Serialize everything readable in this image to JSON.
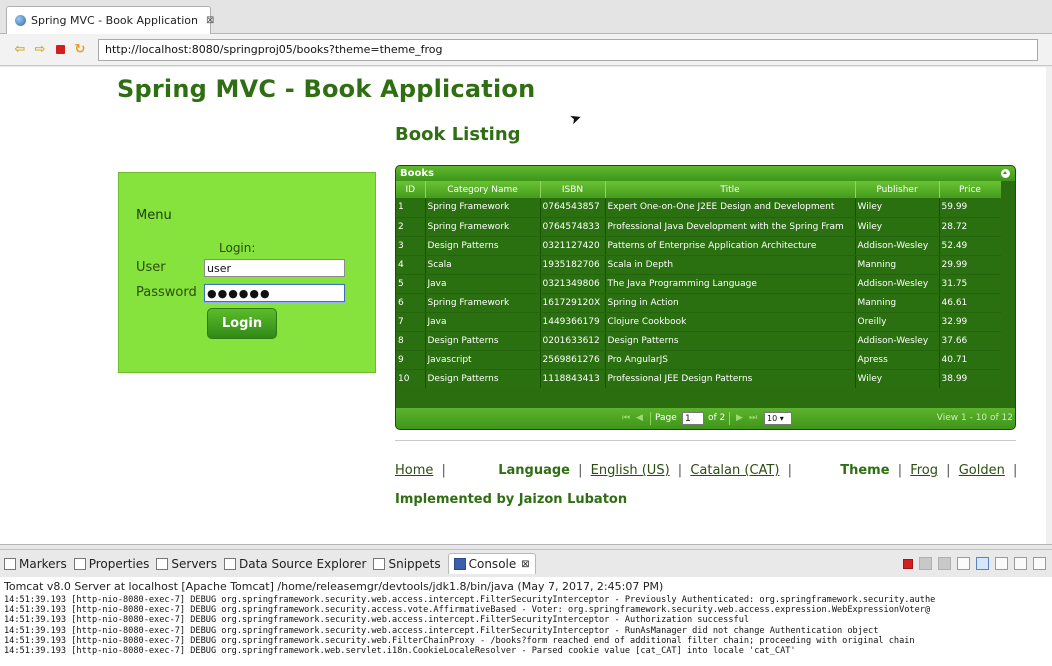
{
  "browser": {
    "tab_title": "Spring MVC - Book Application",
    "tab_close": "⊠",
    "url": "http://localhost:8080/springproj05/books?theme=theme_frog"
  },
  "page": {
    "app_title": "Spring MVC - Book Application",
    "listing_title": "Book Listing"
  },
  "menu": {
    "title": "Menu",
    "login_caption": "Login:",
    "user_label": "User",
    "user_value": "user",
    "password_label": "Password",
    "password_value": "●●●●●●",
    "login_button": "Login"
  },
  "grid": {
    "caption": "Books",
    "columns": [
      "ID",
      "Category Name",
      "ISBN",
      "Title",
      "Publisher",
      "Price"
    ],
    "rows": [
      [
        "1",
        "Spring Framework",
        "0764543857",
        "Expert One-on-One J2EE Design and Development",
        "Wiley",
        "59.99"
      ],
      [
        "2",
        "Spring Framework",
        "0764574833",
        "Professional Java Development with the Spring Fram",
        "Wiley",
        "28.72"
      ],
      [
        "3",
        "Design Patterns",
        "0321127420",
        "Patterns of Enterprise Application Architecture",
        "Addison-Wesley",
        "52.49"
      ],
      [
        "4",
        "Scala",
        "1935182706",
        "Scala in Depth",
        "Manning",
        "29.99"
      ],
      [
        "5",
        "Java",
        "0321349806",
        "The Java Programming Language",
        "Addison-Wesley",
        "31.75"
      ],
      [
        "6",
        "Spring Framework",
        "161729120X",
        "Spring in Action",
        "Manning",
        "46.61"
      ],
      [
        "7",
        "Java",
        "1449366179",
        "Clojure Cookbook",
        "Oreilly",
        "32.99"
      ],
      [
        "8",
        "Design Patterns",
        "0201633612",
        "Design Patterns",
        "Addison-Wesley",
        "37.66"
      ],
      [
        "9",
        "Javascript",
        "2569861276",
        "Pro AngularJS",
        "Apress",
        "40.71"
      ],
      [
        "10",
        "Design Patterns",
        "1118843413",
        "Professional JEE Design Patterns",
        "Wiley",
        "38.99"
      ]
    ],
    "pager": {
      "page_label": "Page",
      "page_value": "1",
      "of_label": "of 2",
      "rows_value": "10 ▾",
      "view_text": "View 1 - 10 of 12"
    }
  },
  "footer": {
    "home": "Home",
    "language_label": "Language",
    "english": "English (US)",
    "catalan": "Catalan (CAT)",
    "theme_label": "Theme",
    "frog": "Frog",
    "golden": "Golden",
    "separator": "|",
    "implemented": "Implemented by Jaizon Lubaton"
  },
  "views": {
    "tabs": [
      {
        "label": "Markers",
        "icon": "markers-icon"
      },
      {
        "label": "Properties",
        "icon": "properties-icon"
      },
      {
        "label": "Servers",
        "icon": "servers-icon"
      },
      {
        "label": "Data Source Explorer",
        "icon": "database-icon"
      },
      {
        "label": "Snippets",
        "icon": "snippets-icon"
      }
    ],
    "active_tab": "Console",
    "active_close": "⊠"
  },
  "console": {
    "header": "Tomcat v8.0 Server at localhost [Apache Tomcat] /home/releasemgr/devtools/jdk1.8/bin/java (May 7, 2017, 2:45:07 PM)",
    "lines": [
      "14:51:39.193 [http-nio-8080-exec-7] DEBUG org.springframework.security.web.access.intercept.FilterSecurityInterceptor - Previously Authenticated: org.springframework.security.authe",
      "14:51:39.193 [http-nio-8080-exec-7] DEBUG org.springframework.security.access.vote.AffirmativeBased - Voter: org.springframework.security.web.access.expression.WebExpressionVoter@",
      "14:51:39.193 [http-nio-8080-exec-7] DEBUG org.springframework.security.web.access.intercept.FilterSecurityInterceptor - Authorization successful",
      "14:51:39.193 [http-nio-8080-exec-7] DEBUG org.springframework.security.web.access.intercept.FilterSecurityInterceptor - RunAsManager did not change Authentication object",
      "14:51:39.193 [http-nio-8080-exec-7] DEBUG org.springframework.security.web.FilterChainProxy - /books?form reached end of additional filter chain; proceeding with original chain",
      "14:51:39.193 [http-nio-8080-exec-7] DEBUG org.springframework.web.servlet.i18n.CookieLocaleResolver - Parsed cookie value [cat_CAT] into locale 'cat_CAT'"
    ]
  }
}
